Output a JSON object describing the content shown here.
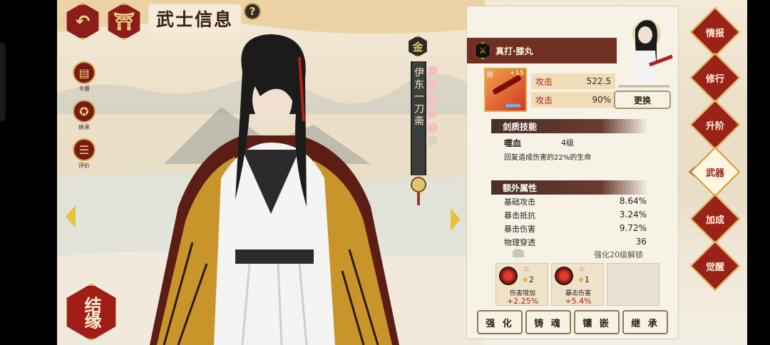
{
  "header": {
    "title": "武士信息",
    "help_label": "?",
    "back_icon": "back-arrow-icon",
    "home_icon": "gate-icon"
  },
  "side_menu": [
    {
      "label": "卡册",
      "icon": "card-album-icon"
    },
    {
      "label": "继承",
      "icon": "pentagram-icon"
    },
    {
      "label": "评价",
      "icon": "comment-icon"
    }
  ],
  "jieyuan_label": "结缘",
  "character": {
    "name": "伊东一刀斋",
    "rank_badge": "金"
  },
  "weapon": {
    "name": "真打·膝丸",
    "card_tag": "绯",
    "enhance": "+15",
    "stats": [
      {
        "label": "攻击",
        "value": "522.5"
      },
      {
        "label": "攻击",
        "value": "90%"
      }
    ],
    "swap_label": "更换"
  },
  "skill_section": {
    "title": "剑质技能",
    "skill_name": "噬血",
    "skill_level": "4级",
    "description": "回复造成伤害的22%的生命"
  },
  "extra_section": {
    "title": "额外属性",
    "attrs": [
      {
        "label": "基础攻击",
        "value": "8.64%"
      },
      {
        "label": "暴击抵抗",
        "value": "3.24%"
      },
      {
        "label": "暴击伤害",
        "value": "9.72%"
      },
      {
        "label": "物理穿透",
        "value": "36"
      }
    ],
    "unlock_note": "强化20级解锁"
  },
  "gems": [
    {
      "stars": "2",
      "name": "伤害增加",
      "value": "+2.25%"
    },
    {
      "stars": "1",
      "name": "暴击伤害",
      "value": "+5.4%"
    },
    {
      "empty": true
    }
  ],
  "actions": [
    "强 化",
    "铸 魂",
    "镶 嵌",
    "继 承"
  ],
  "right_tabs": [
    {
      "label": "情报",
      "active": false
    },
    {
      "label": "修行",
      "active": false
    },
    {
      "label": "升阶",
      "active": false
    },
    {
      "label": "武器",
      "active": true
    },
    {
      "label": "加成",
      "active": false
    },
    {
      "label": "觉醒",
      "active": false
    }
  ],
  "colors": {
    "accent_red": "#9a2218",
    "gold": "#d8a94d",
    "panel": "#f7f2e6"
  }
}
